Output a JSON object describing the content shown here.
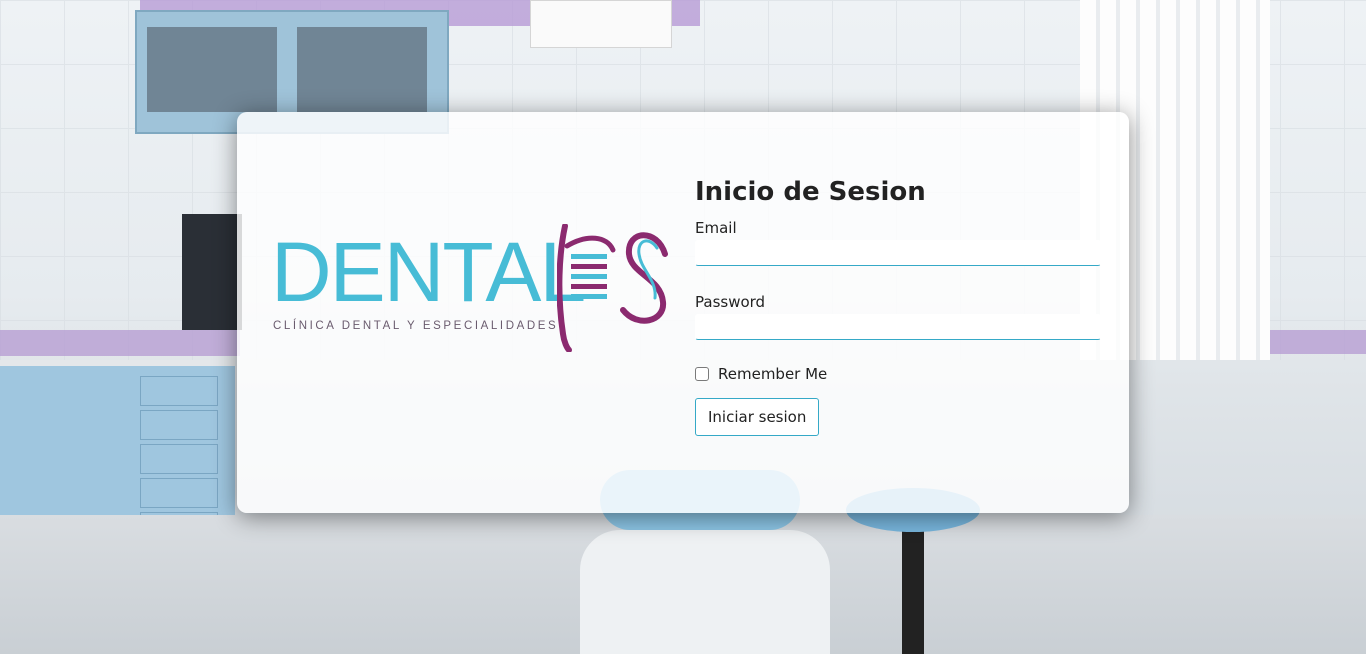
{
  "logo": {
    "wordmark": "DENTAL",
    "subtitle": "CLÍNICA DENTAL Y ESPECIALIDADES",
    "mark_letters": "ES",
    "primary_color": "#47bcd6",
    "accent_color": "#8b2a6f"
  },
  "form": {
    "title": "Inicio de Sesion",
    "email_label": "Email",
    "email_value": "",
    "password_label": "Password",
    "password_value": "",
    "remember_label": "Remember Me",
    "remember_checked": false,
    "submit_label": "Iniciar sesion",
    "accent_color": "#35a9c7"
  }
}
